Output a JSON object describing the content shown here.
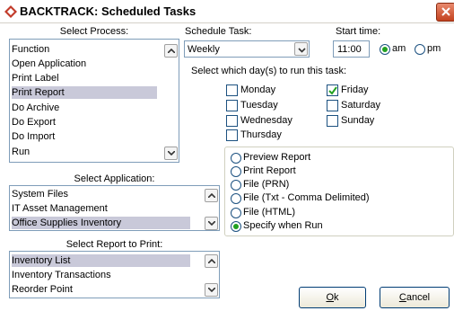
{
  "window": {
    "title": "BACKTRACK:  Scheduled Tasks",
    "app_icon": "backtrack-diamond-icon"
  },
  "process": {
    "label": "Select Process:",
    "items": [
      "Function",
      "Open Application",
      "Print Label",
      "Print Report",
      "Do Archive",
      "Do Export",
      "Do Import",
      "Run"
    ],
    "selected": "Print Report"
  },
  "application": {
    "label": "Select Application:",
    "items": [
      "System Files",
      "IT Asset Management",
      "Office Supplies Inventory"
    ],
    "selected": "Office Supplies Inventory"
  },
  "report": {
    "label": "Select Report to Print:",
    "items": [
      "Inventory List",
      "Inventory Transactions",
      "Reorder Point"
    ],
    "selected": "Inventory List"
  },
  "schedule": {
    "label": "Schedule Task:",
    "value": "Weekly"
  },
  "start_time": {
    "label": "Start time:",
    "value": "11:00",
    "am_label": "am",
    "pm_label": "pm",
    "period": "am"
  },
  "days": {
    "label": "Select which day(s) to run this task:",
    "items": [
      {
        "label": "Monday",
        "checked": false
      },
      {
        "label": "Tuesday",
        "checked": false
      },
      {
        "label": "Wednesday",
        "checked": false
      },
      {
        "label": "Thursday",
        "checked": false
      },
      {
        "label": "Friday",
        "checked": true
      },
      {
        "label": "Saturday",
        "checked": false
      },
      {
        "label": "Sunday",
        "checked": false
      }
    ]
  },
  "output": {
    "options": [
      "Preview Report",
      "Print Report",
      "File (PRN)",
      "File (Txt - Comma Delimited)",
      "File (HTML)",
      "Specify when Run"
    ],
    "selected": "Specify when Run"
  },
  "buttons": {
    "ok_mnemonic": "O",
    "ok_rest": "k",
    "cancel_mnemonic": "C",
    "cancel_rest": "ancel"
  },
  "colors": {
    "selection": "#c9c9d9",
    "radio_dot": "#21a121",
    "check": "#21a121",
    "close": "#d9502e"
  }
}
